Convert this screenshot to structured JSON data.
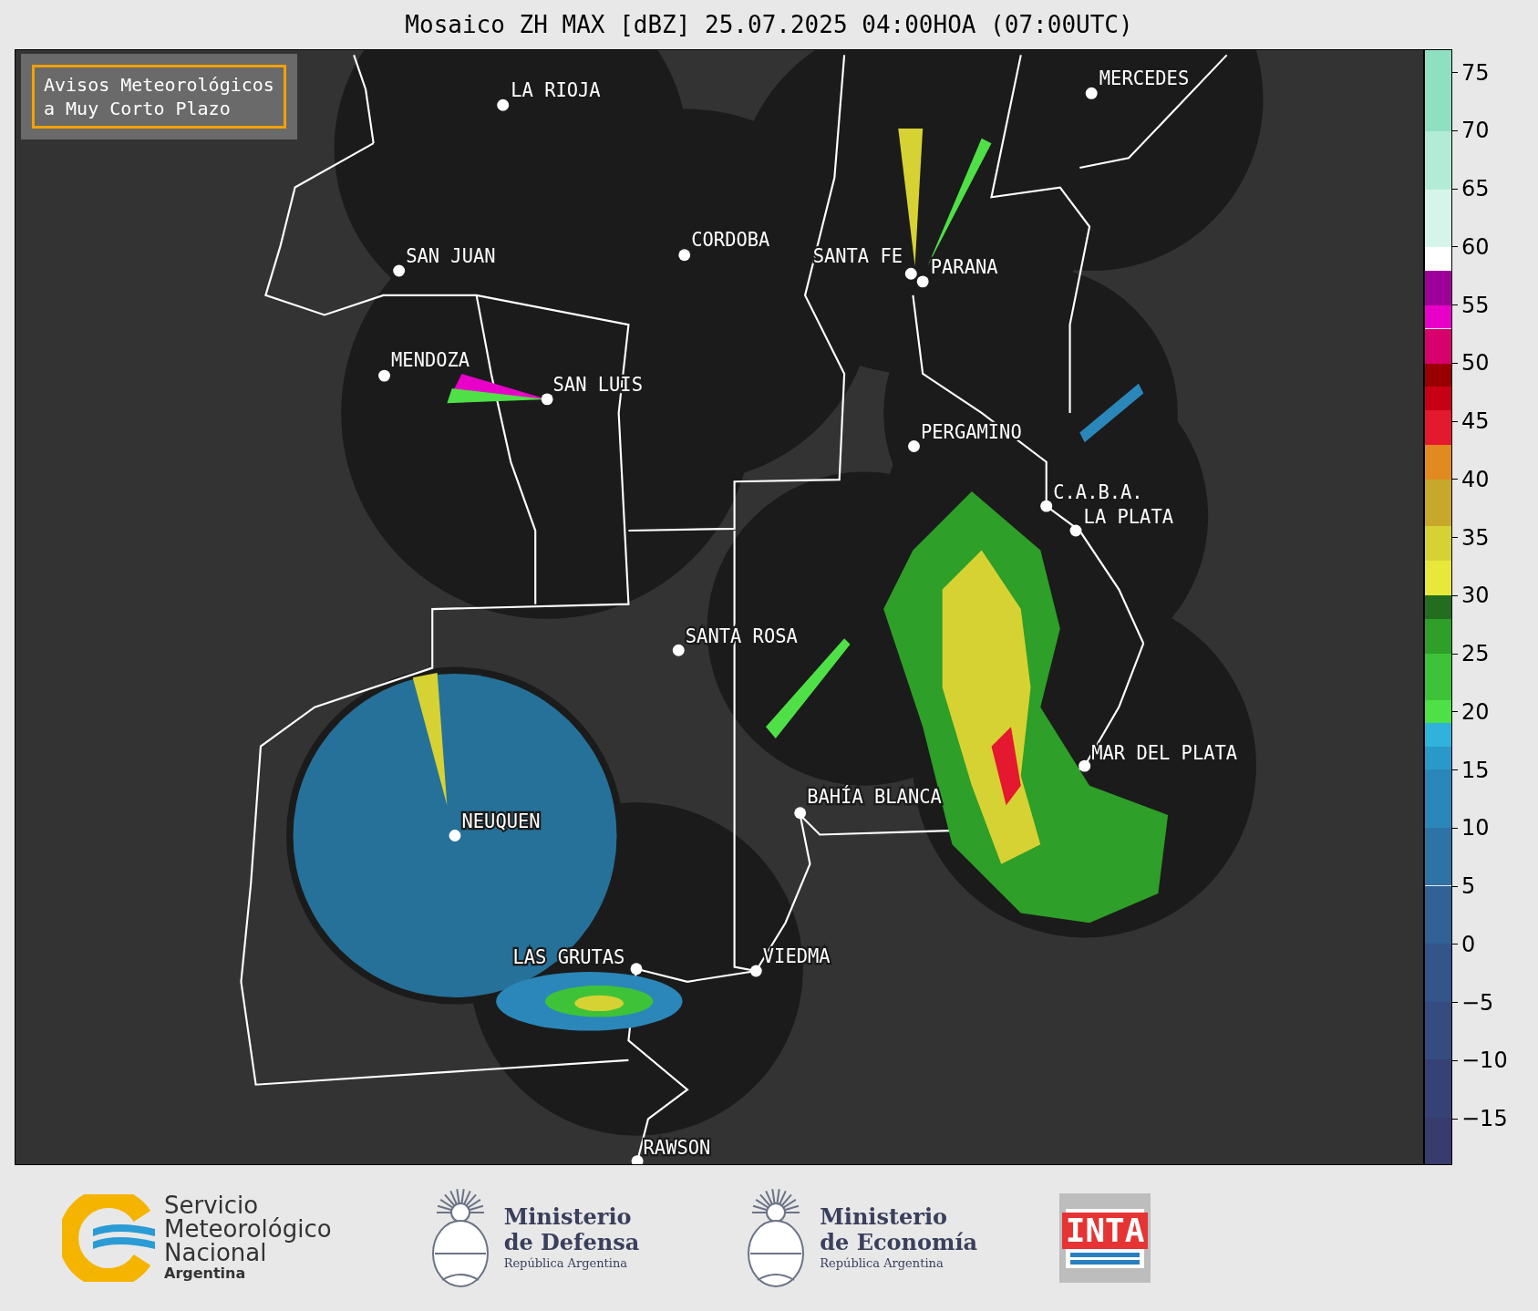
{
  "title": "Mosaico ZH MAX [dBZ] 25.07.2025 04:00HOA (07:00UTC)",
  "notice": {
    "lines": [
      "Avisos Meteorológicos",
      "a Muy Corto Plazo"
    ]
  },
  "cities": [
    {
      "name": "LA RIOJA"
    },
    {
      "name": "MERCEDES"
    },
    {
      "name": "SAN JUAN"
    },
    {
      "name": "CORDOBA"
    },
    {
      "name": "SANTA FE"
    },
    {
      "name": "PARANA"
    },
    {
      "name": "MENDOZA"
    },
    {
      "name": "SAN LUIS"
    },
    {
      "name": "PERGAMINO"
    },
    {
      "name": "C.A.B.A."
    },
    {
      "name": "LA PLATA"
    },
    {
      "name": "SANTA ROSA"
    },
    {
      "name": "MAR DEL PLATA"
    },
    {
      "name": "BAHÍA BLANCA"
    },
    {
      "name": "NEUQUEN"
    },
    {
      "name": "LAS GRUTAS"
    },
    {
      "name": "VIEDMA"
    },
    {
      "name": "RAWSON"
    }
  ],
  "colorbar": {
    "ticks": [
      "75",
      "70",
      "65",
      "60",
      "55",
      "50",
      "45",
      "40",
      "35",
      "30",
      "25",
      "20",
      "15",
      "10",
      "5",
      "0",
      "−5",
      "−10",
      "−15"
    ]
  },
  "footer": {
    "smn": {
      "lines": [
        "Servicio",
        "Meteorológico",
        "Nacional"
      ],
      "country": "Argentina"
    },
    "defensa": {
      "lines": [
        "Ministerio",
        "de Defensa"
      ],
      "country": "República Argentina"
    },
    "economia": {
      "lines": [
        "Ministerio",
        "de Economía"
      ],
      "country": "República Argentina"
    },
    "inta": {
      "text": "INTA"
    }
  }
}
